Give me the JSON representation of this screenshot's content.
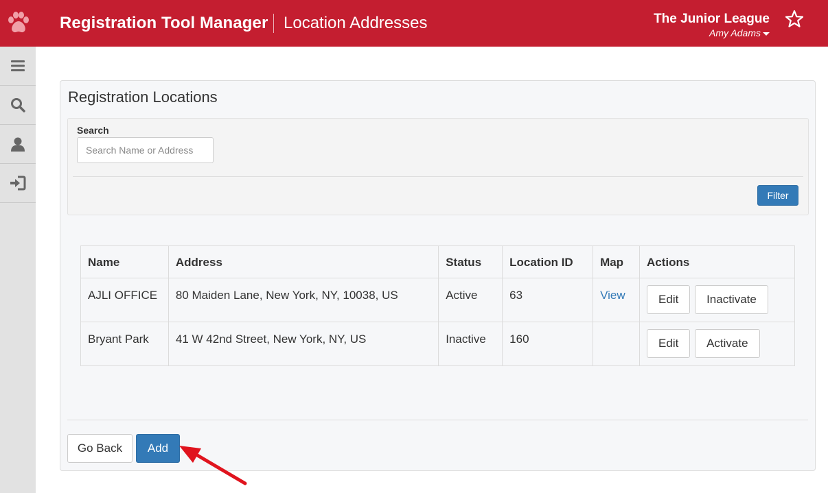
{
  "header": {
    "app_title": "Registration Tool Manager",
    "page_title": "Location Addresses",
    "org_name": "The Junior League",
    "user_name": "Amy Adams",
    "logo_icon": "paw-icon",
    "favorite_icon": "star-icon",
    "color": "#c41e30"
  },
  "sidebar": {
    "items": [
      {
        "icon": "menu-icon"
      },
      {
        "icon": "search-icon"
      },
      {
        "icon": "user-icon"
      },
      {
        "icon": "sign-out-icon"
      }
    ]
  },
  "panel": {
    "title": "Registration Locations",
    "search": {
      "label": "Search",
      "placeholder": "Search Name or Address",
      "value": ""
    },
    "filter_label": "Filter"
  },
  "table": {
    "columns": [
      "Name",
      "Address",
      "Status",
      "Location ID",
      "Map",
      "Actions"
    ],
    "rows": [
      {
        "name": "AJLI OFFICE",
        "address": "80 Maiden Lane, New York, NY, 10038, US",
        "status": "Active",
        "location_id": "63",
        "map": "View",
        "actions": [
          "Edit",
          "Inactivate"
        ]
      },
      {
        "name": "Bryant Park",
        "address": "41 W 42nd Street, New York, NY, US",
        "status": "Inactive",
        "location_id": "160",
        "map": "",
        "actions": [
          "Edit",
          "Activate"
        ]
      }
    ]
  },
  "footer": {
    "go_back_label": "Go Back",
    "add_label": "Add"
  },
  "colors": {
    "brand": "#c41e30",
    "primary_button": "#337ab7",
    "link": "#337ab7",
    "annotation_arrow": "#e0141e"
  }
}
